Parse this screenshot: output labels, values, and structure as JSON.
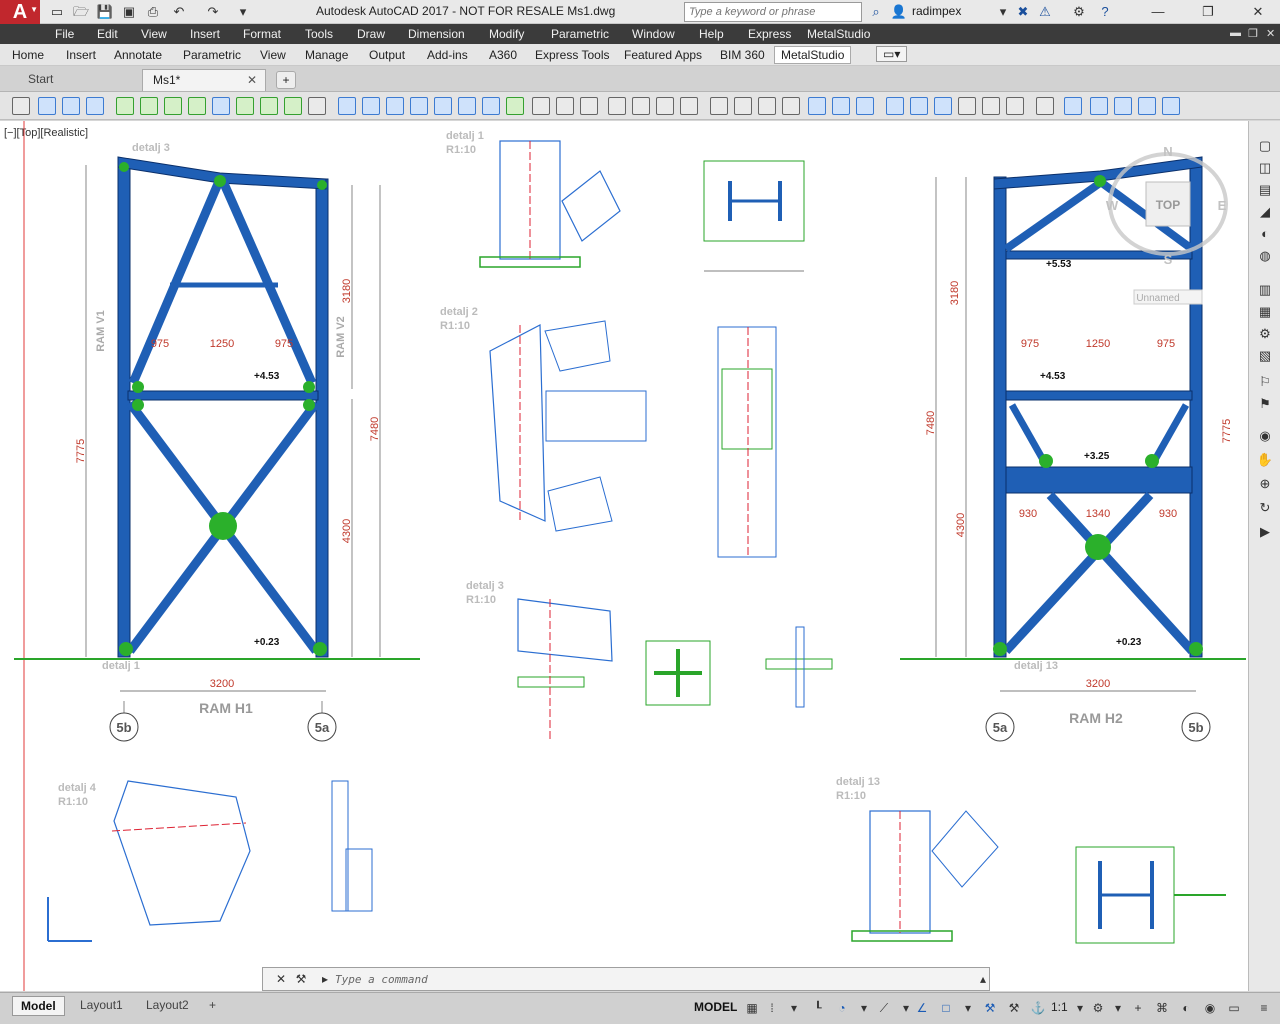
{
  "titlebar": {
    "logo": "A",
    "title": "Autodesk AutoCAD 2017 - NOT FOR RESALE   Ms1.dwg",
    "search_placeholder": "Type a keyword or phrase",
    "user": "radimpex"
  },
  "menu": [
    "File",
    "Edit",
    "View",
    "Insert",
    "Format",
    "Tools",
    "Draw",
    "Dimension",
    "Modify",
    "Parametric",
    "Window",
    "Help",
    "Express",
    "MetalStudio"
  ],
  "ribbon_tabs": [
    "Home",
    "Insert",
    "Annotate",
    "Parametric",
    "View",
    "Manage",
    "Output",
    "Add-ins",
    "A360",
    "Express Tools",
    "Featured Apps",
    "BIM 360",
    "MetalStudio"
  ],
  "active_ribbon_tab": "MetalStudio",
  "doc_tabs": {
    "start": "Start",
    "current": "Ms1*"
  },
  "viewport_label": "[−][Top][Realistic]",
  "viewcube": {
    "top": "TOP",
    "n": "N",
    "e": "E",
    "s": "S",
    "w": "W",
    "ucs": "Unnamed"
  },
  "command": {
    "placeholder": "Type a command"
  },
  "layout_tabs": [
    "Model",
    "Layout1",
    "Layout2"
  ],
  "status": {
    "model": "MODEL",
    "scale": "1:1"
  },
  "drawing": {
    "frame_left": {
      "title": "RAM H1",
      "axis_left": "5b",
      "axis_right": "5a",
      "width_dim": "3200",
      "height_left": "7775",
      "height_right": "7480",
      "height_lower": "4300",
      "height_upper": "3180",
      "beam_dims": [
        "975",
        "1250",
        "975"
      ],
      "elevation_top": "+4.53",
      "elevation_bottom": "+0.23",
      "ram_v1": "RAM V1",
      "ram_v2": "RAM V2"
    },
    "frame_right": {
      "title": "RAM H2",
      "axis_left": "5a",
      "axis_right": "5b",
      "width_dim": "3200",
      "height_left": "7480",
      "height_right": "7775",
      "height_lower": "4300",
      "height_upper": "3180",
      "beam_dims": [
        "975",
        "1250",
        "975"
      ],
      "beam_dims_lower": [
        "930",
        "1340",
        "930"
      ],
      "elevation_top": "+5.53",
      "elevation_mid": "+4.53",
      "elevation_low": "+3.25",
      "elevation_bottom": "+0.23"
    },
    "details": [
      "detalj 1",
      "detalj 2",
      "detalj 3",
      "detalj 4",
      "detalj 13"
    ],
    "detail_scale": "R1:10"
  }
}
